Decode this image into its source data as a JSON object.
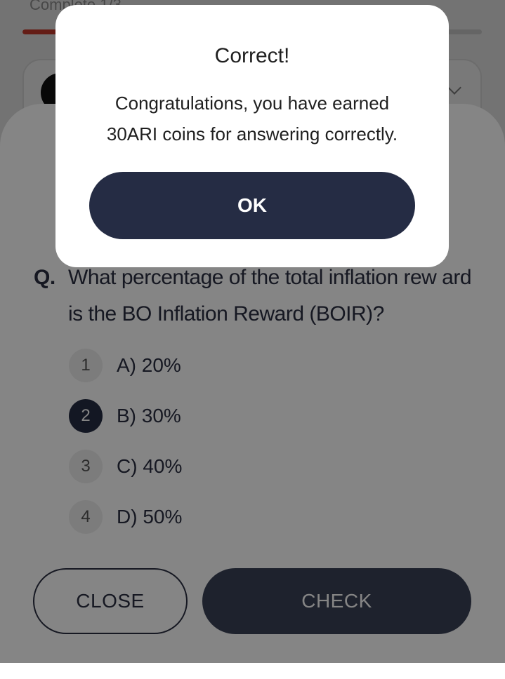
{
  "progress": {
    "label": "Complete 1/3",
    "fraction": 0.08
  },
  "question": {
    "prefix": "Q.",
    "text": "What percentage of the total inflation rew ard is the BO Inflation Reward (BOIR)?"
  },
  "options": [
    {
      "number": "1",
      "label": "A) 20%",
      "selected": false
    },
    {
      "number": "2",
      "label": "B) 30%",
      "selected": true
    },
    {
      "number": "3",
      "label": "C) 40%",
      "selected": false
    },
    {
      "number": "4",
      "label": "D) 50%",
      "selected": false
    }
  ],
  "buttons": {
    "close_label": "CLOSE",
    "check_label": "CHECK"
  },
  "dialog": {
    "title": "Correct!",
    "message_line1": "Congratulations, you have earned",
    "message_line2": "30ARI coins for answering correctly.",
    "ok_label": "OK"
  },
  "colors": {
    "primary": "#252c44",
    "accent": "#c0392b",
    "background": "#ffffff",
    "option_default": "#eeeeee"
  }
}
